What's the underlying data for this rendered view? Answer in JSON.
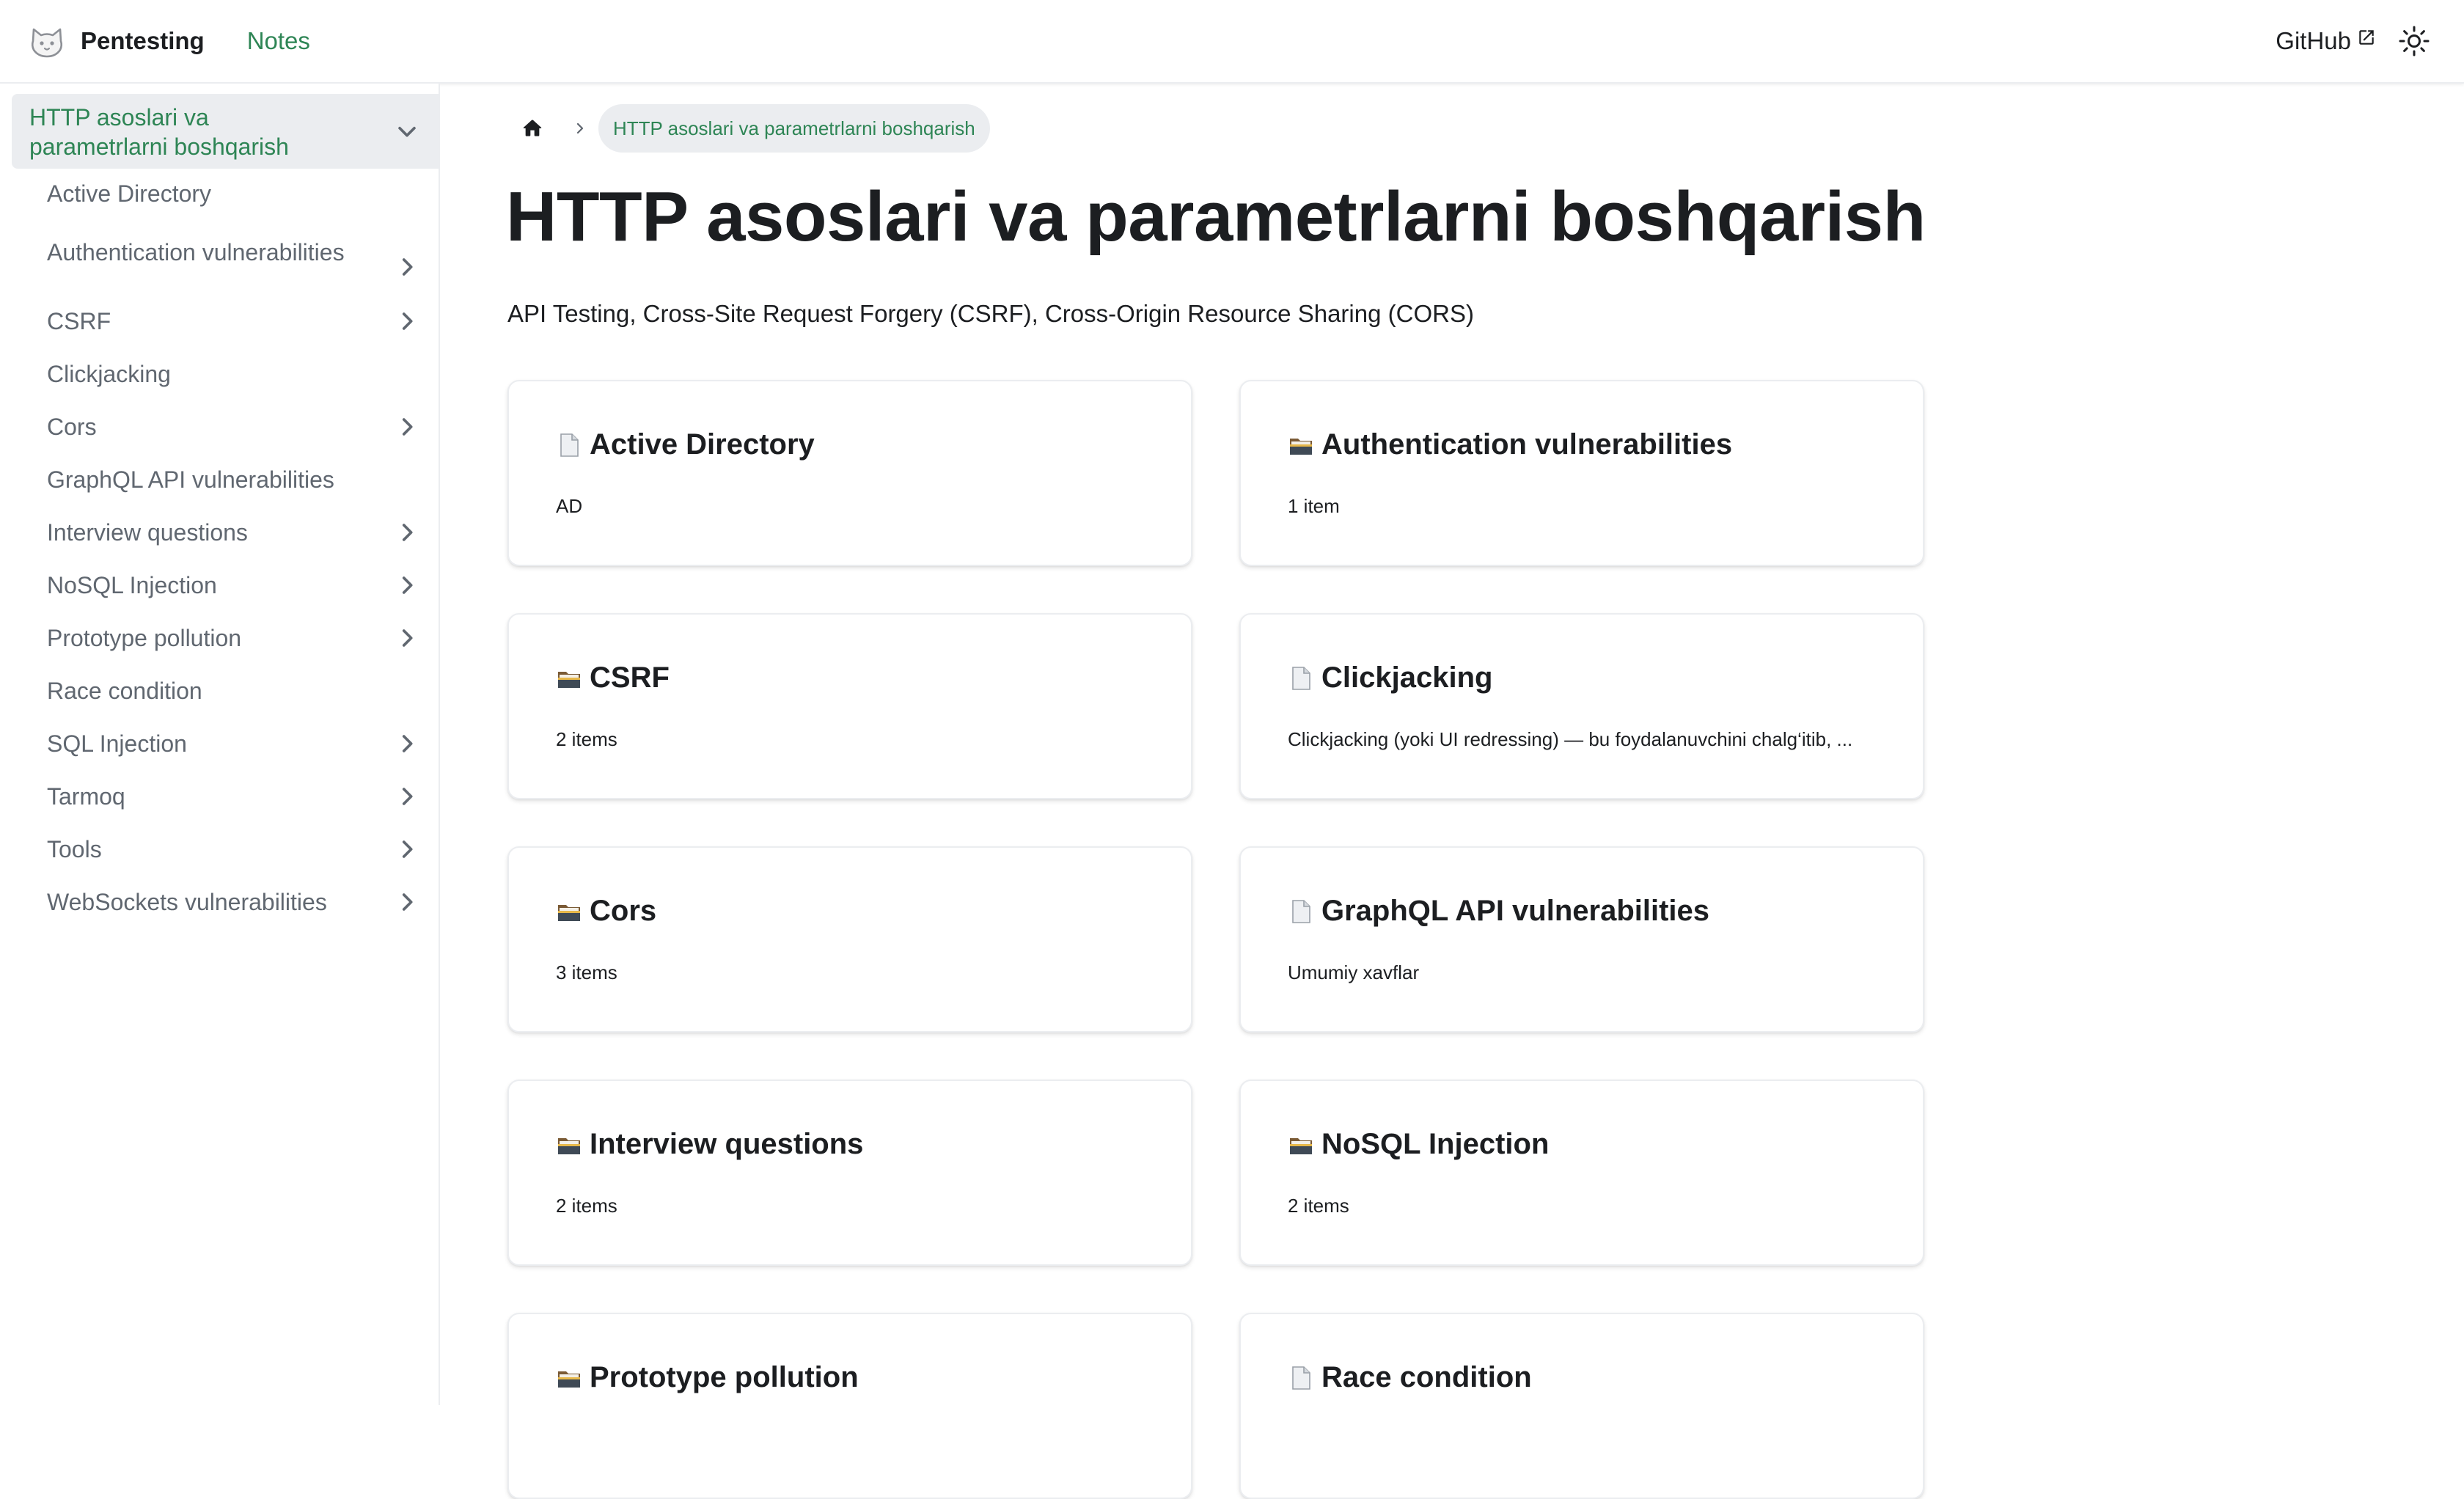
{
  "navbar": {
    "brand_title": "Pentesting",
    "notes_link": "Notes",
    "github_link": "GitHub",
    "logo_icon": "cat-logo-icon",
    "theme_icon": "sun-icon"
  },
  "colors": {
    "accent": "#2e8555",
    "active_bg": "#ebedf0",
    "text": "#1c1e21",
    "muted": "#606770"
  },
  "sidebar": {
    "active_category": "HTTP asoslari va parametrlarni boshqarish",
    "items": [
      {
        "label": "Active Directory",
        "has_children": false
      },
      {
        "label": "Authentication vulnerabilities",
        "has_children": true
      },
      {
        "label": "CSRF",
        "has_children": true
      },
      {
        "label": "Clickjacking",
        "has_children": false
      },
      {
        "label": "Cors",
        "has_children": true
      },
      {
        "label": "GraphQL API vulnerabilities",
        "has_children": false
      },
      {
        "label": "Interview questions",
        "has_children": true
      },
      {
        "label": "NoSQL Injection",
        "has_children": true
      },
      {
        "label": "Prototype pollution",
        "has_children": true
      },
      {
        "label": "Race condition",
        "has_children": false
      },
      {
        "label": "SQL Injection",
        "has_children": true
      },
      {
        "label": "Tarmoq",
        "has_children": true
      },
      {
        "label": "Tools",
        "has_children": true
      },
      {
        "label": "WebSockets vulnerabilities",
        "has_children": true
      }
    ]
  },
  "breadcrumb": {
    "home_icon": "home-icon",
    "current": "HTTP asoslari va parametrlarni boshqarish"
  },
  "main": {
    "title": "HTTP asoslari va parametrlarni boshqarish",
    "description": "API Testing, Cross-Site Request Forgery (CSRF), Cross-Origin Resource Sharing (CORS)",
    "cards": [
      {
        "icon": "document-icon",
        "title": "Active Directory",
        "desc": "AD"
      },
      {
        "icon": "folder-icon",
        "title": "Authentication vulnerabilities",
        "desc": "1 item"
      },
      {
        "icon": "folder-icon",
        "title": "CSRF",
        "desc": "2 items"
      },
      {
        "icon": "document-icon",
        "title": "Clickjacking",
        "desc": "Clickjacking (yoki UI redressing) — bu foydalanuvchini chalg‘itib, ..."
      },
      {
        "icon": "folder-icon",
        "title": "Cors",
        "desc": "3 items"
      },
      {
        "icon": "document-icon",
        "title": "GraphQL API vulnerabilities",
        "desc": "Umumiy xavflar"
      },
      {
        "icon": "folder-icon",
        "title": "Interview questions",
        "desc": "2 items"
      },
      {
        "icon": "folder-icon",
        "title": "NoSQL Injection",
        "desc": "2 items"
      },
      {
        "icon": "folder-icon",
        "title": "Prototype pollution",
        "desc": ""
      },
      {
        "icon": "document-icon",
        "title": "Race condition",
        "desc": ""
      }
    ]
  }
}
